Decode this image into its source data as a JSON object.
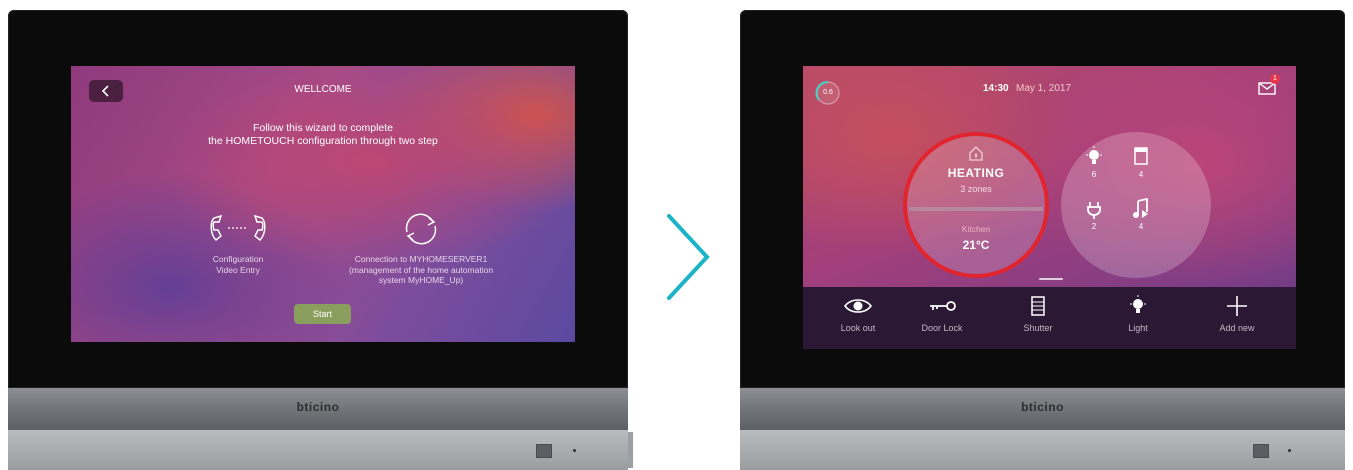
{
  "left_device": {
    "brand": "bticino",
    "screen": {
      "title": "WELLCOME",
      "description_line1": "Follow this wizard to complete",
      "description_line2": "the HOMETOUCH configuration through two step",
      "option_video": {
        "line1": "Configuration",
        "line2": "Video Entry",
        "icon": "handset-pair-icon"
      },
      "option_server": {
        "line1": "Connection to MYHOMESERVER1",
        "line2": "(management of the home automation",
        "line3": "system MyHOME_Up)",
        "icon": "sync-arrows-icon"
      },
      "start_label": "Start",
      "start_color": "#8a9f5e"
    }
  },
  "right_device": {
    "brand": "bticino",
    "screen": {
      "temperature_badge": "0.6",
      "time": "14:30",
      "date": "May 1, 2017",
      "mail_badge": "1",
      "heating": {
        "title": "HEATING",
        "subtitle": "3 zones",
        "zone_name": "Kitchen",
        "zone_temp": "21°C",
        "ring_color": "#e2242f"
      },
      "devices": [
        {
          "name": "light",
          "count": "6",
          "icon": "bulb-icon"
        },
        {
          "name": "shutter",
          "count": "4",
          "icon": "shutter-icon"
        },
        {
          "name": "plug",
          "count": "2",
          "icon": "plug-icon"
        },
        {
          "name": "music",
          "count": "4",
          "icon": "music-icon"
        }
      ],
      "dock": [
        {
          "label": "Look out",
          "icon": "eye-icon"
        },
        {
          "label": "Door Lock",
          "icon": "key-icon"
        },
        {
          "label": "Shutter",
          "icon": "shutter-icon"
        },
        {
          "label": "Light",
          "icon": "bulb-icon"
        },
        {
          "label": "Add new",
          "icon": "plus-icon"
        }
      ]
    }
  },
  "arrow_color": "#1bb3c7"
}
